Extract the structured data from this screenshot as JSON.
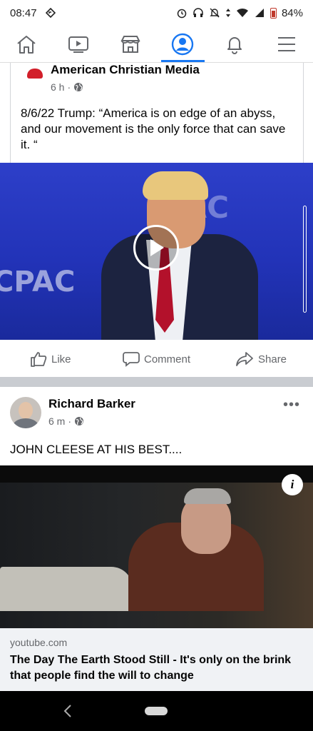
{
  "status_bar": {
    "time": "08:47",
    "battery": "84%"
  },
  "nav": {
    "tabs": [
      "home-icon",
      "video-icon",
      "marketplace-icon",
      "profile-icon",
      "notifications-icon",
      "menu-icon"
    ],
    "active_index": 3,
    "accent": "#1877f2"
  },
  "post1": {
    "author": "American Christian Media",
    "time": "6 h",
    "text": "8/6/22 Trump: “America is on edge of an abyss, and our movement is the only force that can save it. “",
    "video_watermark_1": "AC",
    "video_watermark_2": "CPAC",
    "actions": {
      "like": "Like",
      "comment": "Comment",
      "share": "Share"
    }
  },
  "post2": {
    "author": "Richard Barker",
    "time": "6 m",
    "more": "•••",
    "text": "JOHN CLEESE AT HIS BEST....",
    "info": "i",
    "link": {
      "domain": "youtube.com",
      "title": "The Day The Earth Stood Still - It's only on the brink that people find the will to change"
    }
  }
}
